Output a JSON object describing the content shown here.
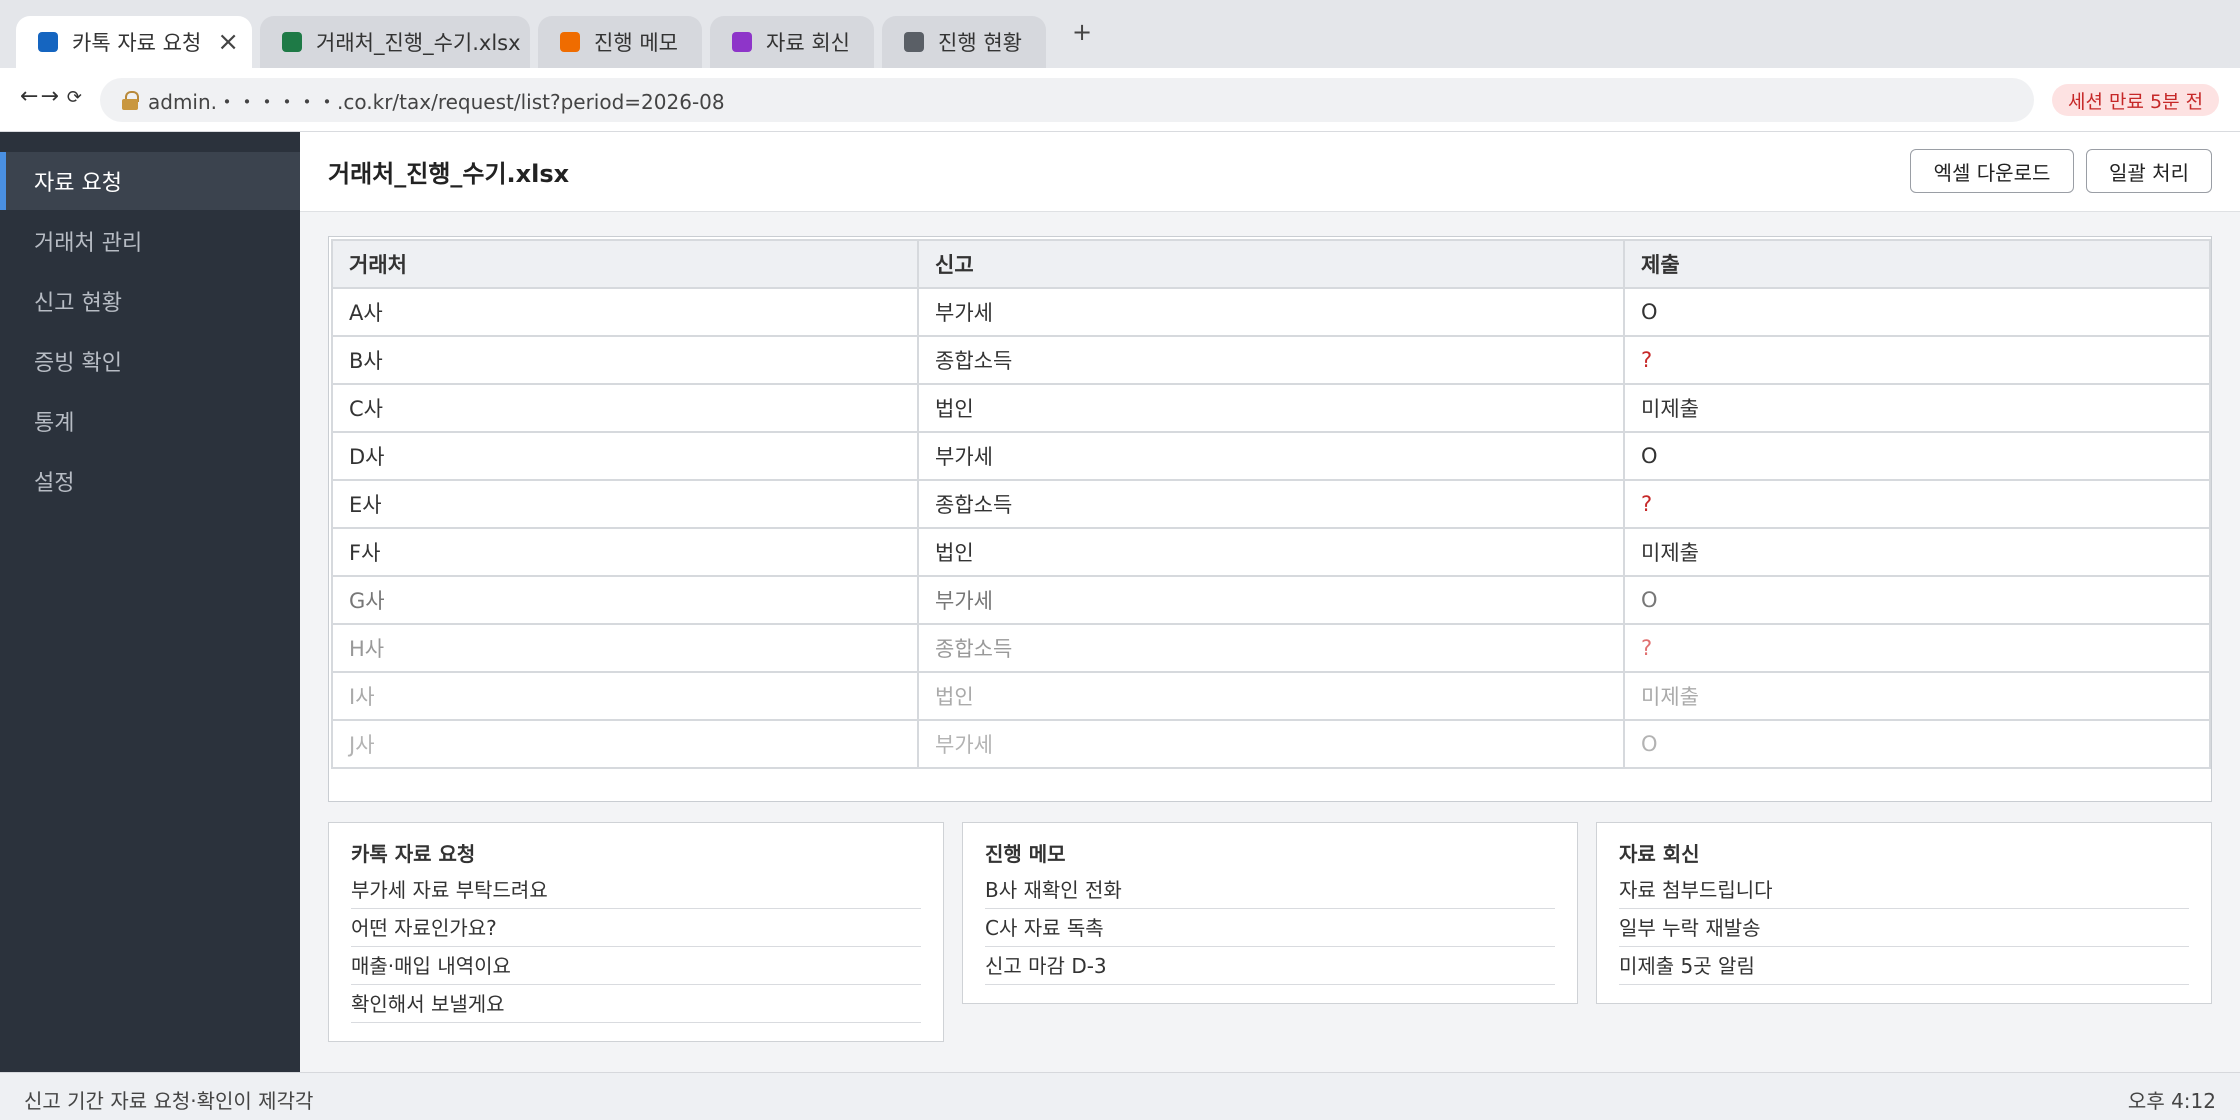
{
  "colors": {
    "tab_kakao": "#1565c0",
    "tab_excel": "#1e7a46",
    "tab_memo": "#ef6c00",
    "tab_reply": "#8e35c9",
    "tab_status": "#5a5f66",
    "accent": "#4a90e2",
    "danger": "#c62828"
  },
  "tabs": [
    {
      "label": "카톡 자료 요청"
    },
    {
      "label": "거래처_진행_수기.xlsx"
    },
    {
      "label": "진행 메모"
    },
    {
      "label": "자료 회신"
    },
    {
      "label": "진행 현황"
    }
  ],
  "new_tab_label": "+",
  "nav": {
    "back": "←",
    "forward": "→",
    "reload": "⟳"
  },
  "url": "admin.・・・・・・.co.kr/tax/request/list?period=2026-08",
  "session_badge": "세션 만료 5분 전",
  "sidebar": {
    "items": [
      {
        "label": "자료 요청",
        "active": true
      },
      {
        "label": "거래처 관리"
      },
      {
        "label": "신고 현황"
      },
      {
        "label": "증빙 확인"
      },
      {
        "label": "통계"
      },
      {
        "label": "설정"
      }
    ]
  },
  "main": {
    "title": "거래처_진행_수기.xlsx",
    "excel_download": "엑셀 다운로드",
    "batch_process": "일괄 처리"
  },
  "table": {
    "headers": [
      "거래처",
      "신고",
      "제출"
    ],
    "rows": [
      [
        "A사",
        "부가세",
        "O"
      ],
      [
        "B사",
        "종합소득",
        "?"
      ],
      [
        "C사",
        "법인",
        "미제출"
      ],
      [
        "D사",
        "부가세",
        "O"
      ],
      [
        "E사",
        "종합소득",
        "?"
      ],
      [
        "F사",
        "법인",
        "미제출"
      ],
      [
        "G사",
        "부가세",
        "O"
      ],
      [
        "H사",
        "종합소득",
        "?"
      ],
      [
        "I사",
        "법인",
        "미제출"
      ],
      [
        "J사",
        "부가세",
        "O"
      ]
    ]
  },
  "cards": [
    {
      "title": "카톡 자료 요청",
      "lines": [
        "부가세 자료 부탁드려요",
        "어떤 자료인가요?",
        "매출·매입 내역이요",
        "확인해서 보낼게요"
      ]
    },
    {
      "title": "진행 메모",
      "lines": [
        "B사 재확인 전화",
        "C사 자료 독촉",
        "신고 마감 D-3"
      ]
    },
    {
      "title": "자료 회신",
      "lines": [
        "자료 첨부드립니다",
        "일부 누락 재발송",
        "미제출 5곳 알림"
      ]
    }
  ],
  "status": {
    "left": "신고 기간 자료 요청·확인이 제각각",
    "right": "오후 4:12"
  }
}
